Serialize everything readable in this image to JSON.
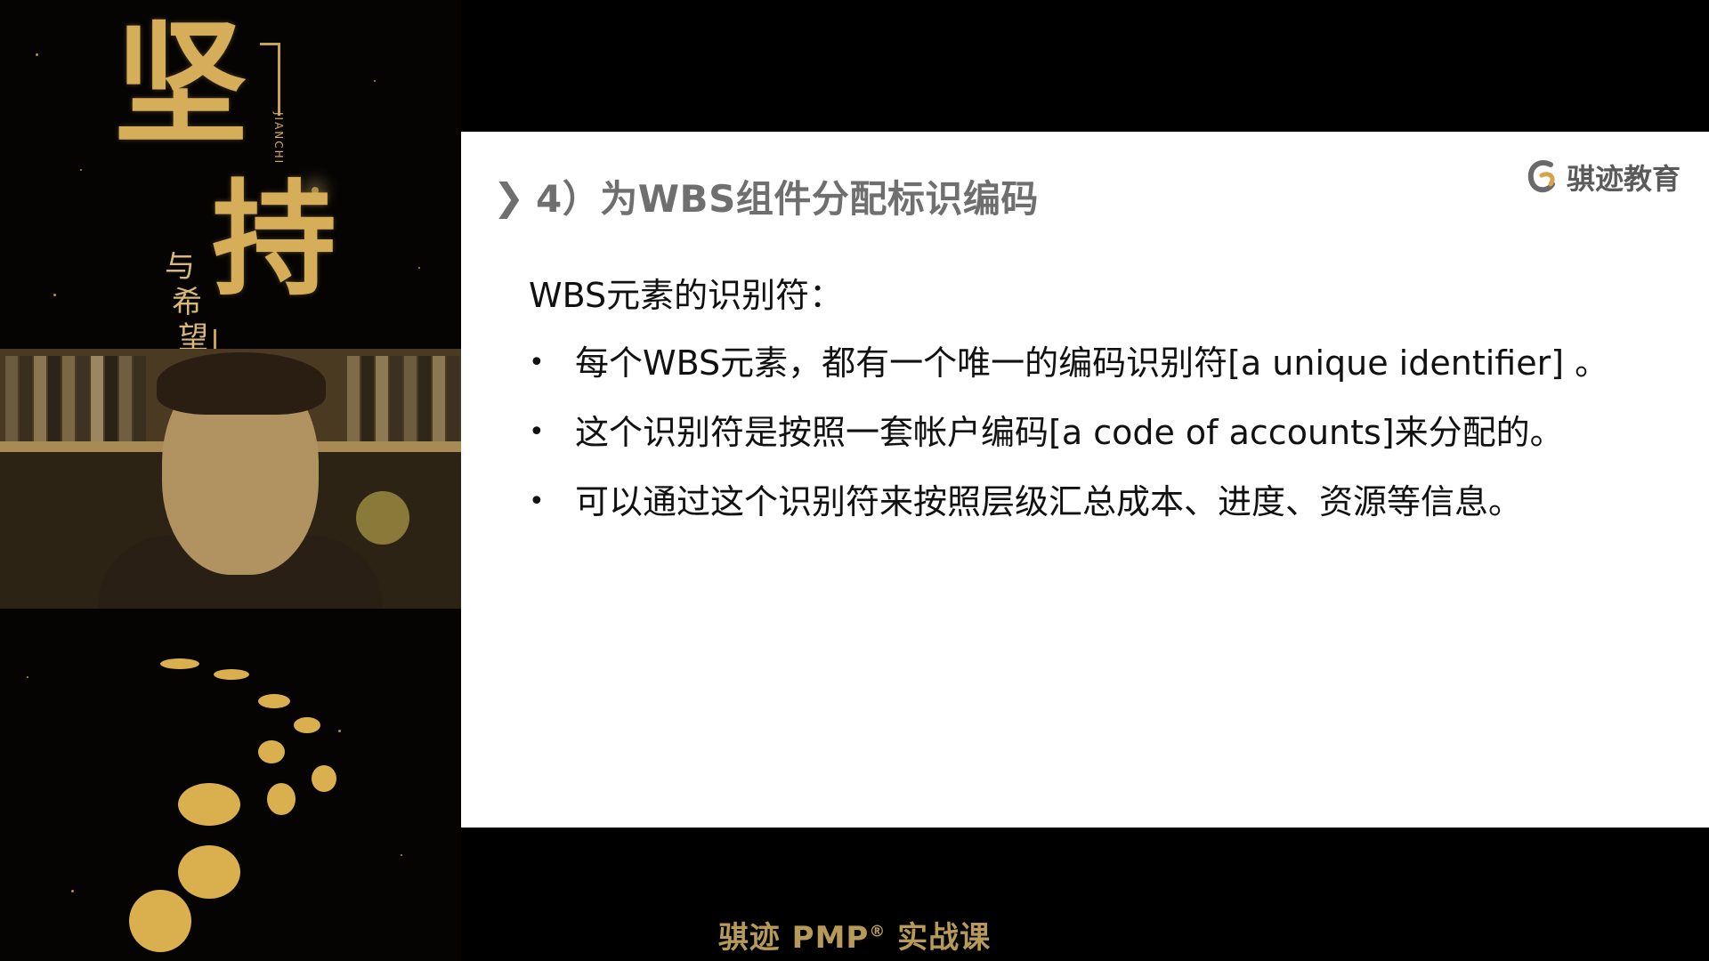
{
  "poster": {
    "title_chars": [
      "坚",
      "持"
    ],
    "subtitle_chars": [
      "与",
      "希",
      "望"
    ],
    "pinyin": "JIANCHI"
  },
  "slide": {
    "number": "4）",
    "title": "为WBS组件分配标识编码",
    "brand": "骐迹教育",
    "heading": "WBS元素的识别符：",
    "bullets": [
      "每个WBS元素，都有一个唯一的编码识别符[a unique identifier] 。",
      "这个识别符是按照一套帐户编码[a code of accounts]来分配的。",
      "可以通过这个识别符来按照层级汇总成本、进度、资源等信息。"
    ]
  },
  "footer": {
    "text": "骐迹 PMP",
    "reg": "®",
    "suffix": " 实战课"
  },
  "colors": {
    "gold": "#d6ad58",
    "slide_bg": "#ffffff",
    "title_gray": "#6f6f6f"
  }
}
